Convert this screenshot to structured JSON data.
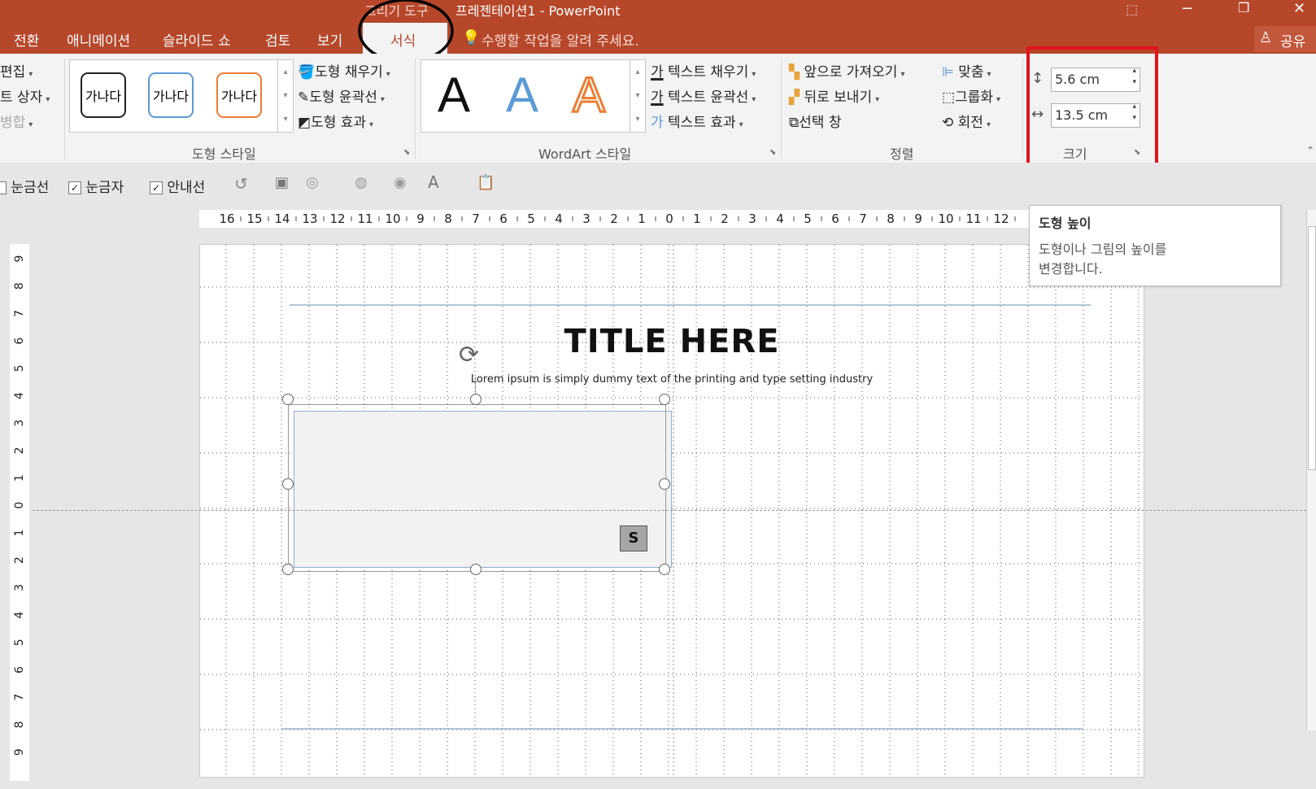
{
  "window": {
    "title_context": "그리기 도구",
    "title": "프레젠테이션1 - PowerPoint",
    "share": "공유"
  },
  "tabs": [
    "전환",
    "애니메이션",
    "슬라이드 쇼",
    "검토",
    "보기",
    "서식"
  ],
  "active_tab": "서식",
  "tell_me": "수행할 작업을 알려 주세요.",
  "ribbon": {
    "left_cut": [
      "편집",
      "트 상자",
      "병합"
    ],
    "shape_styles": {
      "samples": [
        "가나다",
        "가나다",
        "가나다"
      ],
      "fill": "도형 채우기",
      "outline": "도형 윤곽선",
      "effects": "도형 효과",
      "label": "도형 스타일"
    },
    "wordart": {
      "samples": [
        "A",
        "A",
        "A"
      ],
      "fill": "텍스트 채우기",
      "outline": "텍스트 윤곽선",
      "effects": "텍스트 효과",
      "label": "WordArt 스타일"
    },
    "arrange": {
      "bring_forward": "앞으로 가져오기",
      "send_backward": "뒤로 보내기",
      "selection_pane": "선택 창",
      "align": "맞춤",
      "group": "그룹화",
      "rotate": "회전",
      "label": "정렬"
    },
    "size": {
      "height": "5.6 cm",
      "width": "13.5 cm",
      "label": "크기"
    }
  },
  "view_options": {
    "gridlines": "눈금선",
    "ruler": "눈금자",
    "guides": "안내선"
  },
  "ruler": {
    "h_ticks": [
      "16",
      "15",
      "14",
      "13",
      "12",
      "11",
      "10",
      "9",
      "8",
      "7",
      "6",
      "5",
      "4",
      "3",
      "2",
      "1",
      "0",
      "1",
      "2",
      "3",
      "4",
      "5",
      "6",
      "7",
      "8",
      "9",
      "10",
      "11",
      "12"
    ],
    "v_ticks": [
      "9",
      "8",
      "7",
      "6",
      "5",
      "4",
      "3",
      "2",
      "1",
      "0",
      "1",
      "2",
      "3",
      "4",
      "5",
      "6",
      "7",
      "8",
      "9"
    ]
  },
  "slide": {
    "title": "TITLE HERE",
    "subtitle": "Lorem ipsum is simply dummy text of the printing and type setting industry",
    "badge": "S"
  },
  "tooltip": {
    "title": "도형 높이",
    "line1": "도형이나 그림의 높이를",
    "line2": "변경합니다."
  },
  "colors": {
    "accent": "#b7472a",
    "annotation_red": "#e0141e",
    "wordart_blue": "#5b9bd5",
    "wordart_orange": "#ed7d31"
  }
}
